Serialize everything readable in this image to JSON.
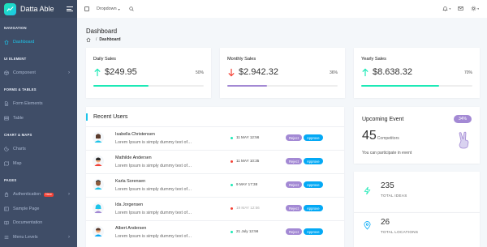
{
  "brand": {
    "name": "Datta Able"
  },
  "sidebar": {
    "captions": [
      "NAVIGATION",
      "UI ELEMENT",
      "FORMS & TABLES",
      "CHART & MAPS",
      "PAGES"
    ],
    "items": [
      {
        "label": "Dashboard",
        "icon": "home-icon"
      },
      {
        "label": "Component",
        "icon": "box-icon"
      },
      {
        "label": "Form Elements",
        "icon": "file-text-icon"
      },
      {
        "label": "Table",
        "icon": "server-icon"
      },
      {
        "label": "Charts",
        "icon": "pie-chart-icon"
      },
      {
        "label": "Map",
        "icon": "map-icon"
      },
      {
        "label": "Authentication",
        "icon": "lock-icon",
        "badge": "New"
      },
      {
        "label": "Sample Page",
        "icon": "sidebar-icon"
      },
      {
        "label": "Documentation",
        "icon": "book-icon"
      },
      {
        "label": "Menu Levels",
        "icon": "menu-icon"
      }
    ]
  },
  "header": {
    "dropdown_label": "Dropdown"
  },
  "page": {
    "title": "Dashboard",
    "breadcrumb_current": "Dashboard"
  },
  "stats": [
    {
      "title": "Daily Sales",
      "value": "$249.95",
      "percent": "50%",
      "progress": 0.5,
      "trend": "up",
      "bar_color": "#1de9b6"
    },
    {
      "title": "Monthly Sales",
      "value": "$2.942.32",
      "percent": "36%",
      "progress": 0.36,
      "trend": "down",
      "bar_color": "#a389d4"
    },
    {
      "title": "Yearly Sales",
      "value": "$8.638.32",
      "percent": "70%",
      "progress": 0.7,
      "trend": "up",
      "bar_color": "#1de9b6"
    }
  ],
  "recent_users": {
    "title": "Recent Users",
    "reject_label": "Reject",
    "approve_label": "Approve",
    "rows": [
      {
        "name": "Isabella Christensen",
        "desc": "Lorem Ipsum is simply dummy text of…",
        "date": "11 MAY 12:56",
        "status_color": "#1de9b6",
        "muted": false
      },
      {
        "name": "Mathilde Andersen",
        "desc": "Lorem Ipsum is simply dummy text of…",
        "date": "11 MAY 10:35",
        "status_color": "#f44236",
        "muted": false
      },
      {
        "name": "Karla Sorensen",
        "desc": "Lorem Ipsum is simply dummy text of…",
        "date": "9 MAY 17:38",
        "status_color": "#1de9b6",
        "muted": false
      },
      {
        "name": "Ida Jorgensen",
        "desc": "Lorem Ipsum is simply dummy text of…",
        "date": "19 MAY 12:56",
        "status_color": "#f44236",
        "muted": true
      },
      {
        "name": "Albert Andersen",
        "desc": "Lorem Ipsum is simply dummy text of…",
        "date": "21 July 12:56",
        "status_color": "#1de9b6",
        "muted": false
      }
    ]
  },
  "event": {
    "title": "Upcoming Event",
    "badge": "34%",
    "count": "45",
    "count_label": "Competitors",
    "subtitle": "You can participate in event"
  },
  "kpis": [
    {
      "value": "235",
      "label": "TOTAL IDEAS",
      "icon": "zap-icon"
    },
    {
      "value": "26",
      "label": "TOTAL LOCATIONS",
      "icon": "map-pin-icon"
    }
  ],
  "colors": {
    "sidebar": "#3f4d67",
    "accent": "#1dc4e9",
    "teal": "#1de9b6",
    "purple": "#a389d4",
    "red": "#f44236",
    "blue": "#04a9f5"
  }
}
